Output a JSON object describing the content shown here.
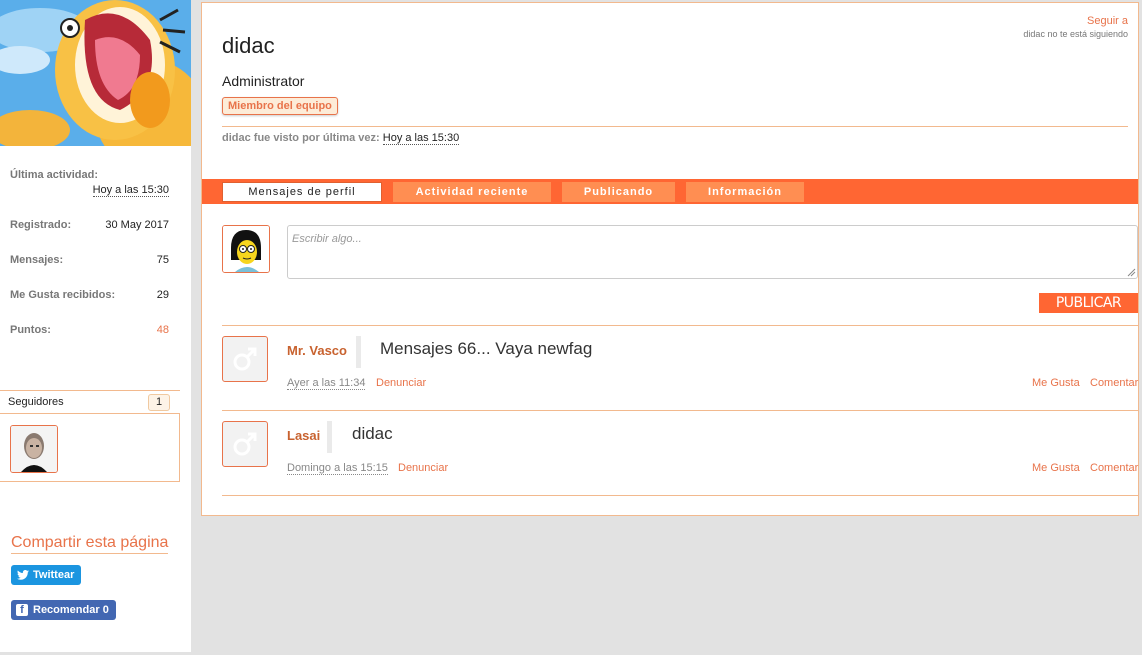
{
  "profile": {
    "username": "didac",
    "role": "Administrator",
    "badge": "Miembro del equipo",
    "follow_link": "Seguir a",
    "follow_status": "didac no te está siguiendo",
    "last_seen_label": "didac fue visto por última vez:",
    "last_seen_time": "Hoy a las 15:30"
  },
  "sidebar": {
    "last_activity_label": "Última actividad:",
    "last_activity_value": "Hoy a las 15:30",
    "stats": [
      {
        "label": "Registrado:",
        "value": "30 May 2017"
      },
      {
        "label": "Mensajes:",
        "value": "75"
      },
      {
        "label": "Me Gusta recibidos:",
        "value": "29"
      },
      {
        "label": "Puntos:",
        "value": "48"
      }
    ],
    "followers_label": "Seguidores",
    "followers_count": "1",
    "share_title": "Compartir esta página",
    "twitter_label": "Twittear",
    "facebook_label": "Recomendar 0"
  },
  "tabs": [
    "Mensajes de perfil",
    "Actividad reciente",
    "Publicando",
    "Información"
  ],
  "composer": {
    "placeholder": "Escribir algo...",
    "publish_label": "PUBLICAR"
  },
  "messages": [
    {
      "author": "Mr. Vasco",
      "text": "Mensajes 66... Vaya newfag",
      "time": "Ayer a las 11:34",
      "report": "Denunciar",
      "like": "Me Gusta",
      "comment": "Comentar"
    },
    {
      "author": "Lasai",
      "text": "didac",
      "time": "Domingo a las 15:15",
      "report": "Denunciar",
      "like": "Me Gusta",
      "comment": "Comentar"
    }
  ],
  "colors": {
    "accent": "#ff6633",
    "tab": "#ff8e52",
    "link": "#e8734a",
    "twitter": "#1b95e0",
    "facebook": "#4267b2"
  }
}
